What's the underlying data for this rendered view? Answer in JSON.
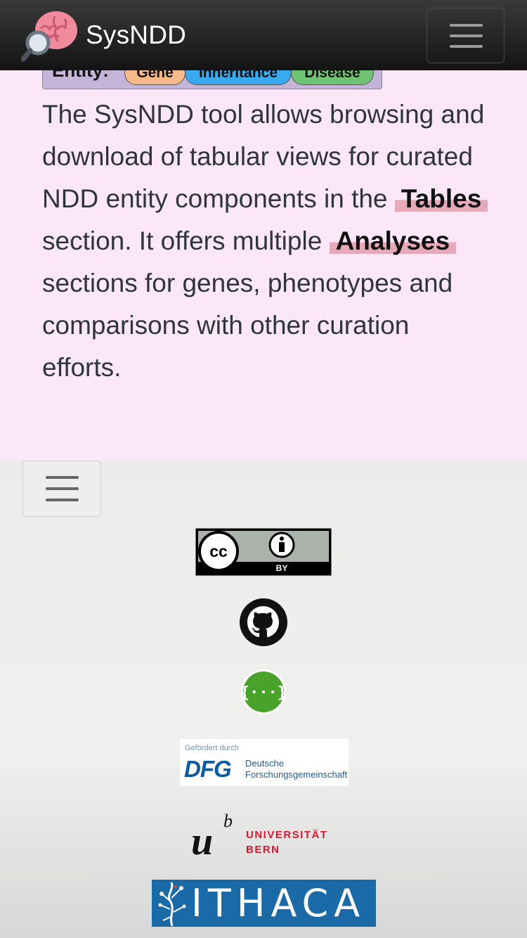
{
  "navbar": {
    "brand_name": "SysNDD",
    "toggle_icon": "hamburger-menu-icon"
  },
  "entity_card": {
    "label": "Entity:",
    "pills": {
      "gene": "Gene",
      "inheritance": "Inheritance",
      "disease": "Disease"
    },
    "colors": {
      "gene": "#f7b98a",
      "inheritance": "#3aaaf0",
      "disease": "#6ec472"
    }
  },
  "intro": {
    "part1": "The SysNDD tool allows browsing and download of tabular views for curated NDD entity components in the",
    "tables_link": "Tables",
    "part2": "section. It offers multiple",
    "analyses_link": "Analyses",
    "part3": "sections for genes, phenotypes and comparisons with other curation efforts."
  },
  "footer": {
    "toggle_icon": "hamburger-menu-icon",
    "cc_badge": {
      "by": "BY"
    },
    "dfg": {
      "small": "Gefördert durch",
      "big": "DFG",
      "name_line1": "Deutsche",
      "name_line2": "Forschungsgemeinschaft"
    },
    "unibe": {
      "u": "u",
      "b": "b",
      "line1": "UNIVERSITÄT",
      "line2": "BERN"
    },
    "ithaka": {
      "text": "ITHACA"
    }
  }
}
